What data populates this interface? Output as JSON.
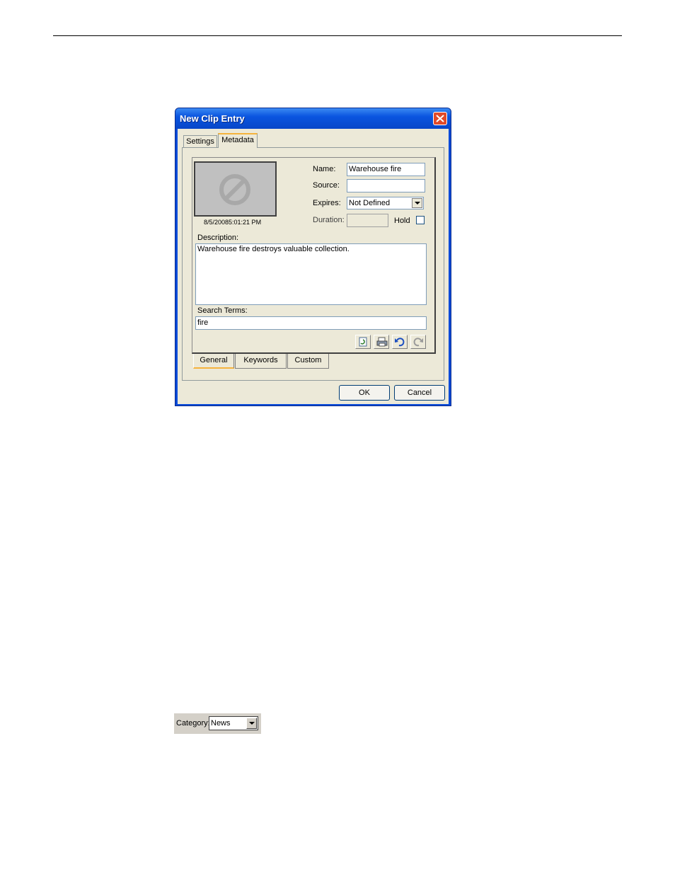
{
  "dialog": {
    "title": "New Clip Entry",
    "tabs": [
      "Settings",
      "Metadata"
    ],
    "active_tab": "Metadata",
    "thumbnail": {
      "icon": "no-image-icon",
      "timestamp": "8/5/20085:01:21 PM"
    },
    "fields": {
      "name_label": "Name:",
      "name_value": "Warehouse fire",
      "source_label": "Source:",
      "source_value": "",
      "expires_label": "Expires:",
      "expires_value": "Not Defined",
      "duration_label": "Duration:",
      "duration_value": "",
      "hold_label": "Hold",
      "hold_checked": false
    },
    "description_label": "Description:",
    "description_value": "Warehouse fire destroys valuable collection.",
    "search_terms_label": "Search Terms:",
    "search_terms_value": "fire",
    "toolbar_icons": [
      "refresh-icon",
      "print-icon",
      "undo-icon",
      "redo-icon"
    ],
    "bottom_tabs": [
      "General",
      "Keywords",
      "Custom"
    ],
    "active_bottom_tab": "General",
    "ok_label": "OK",
    "cancel_label": "Cancel"
  },
  "category_bar": {
    "label": "Category:",
    "value": "News"
  },
  "colors": {
    "titlebar": "#0a55e0",
    "close_button": "#e14a2a",
    "dialog_bg": "#ece9d8"
  }
}
